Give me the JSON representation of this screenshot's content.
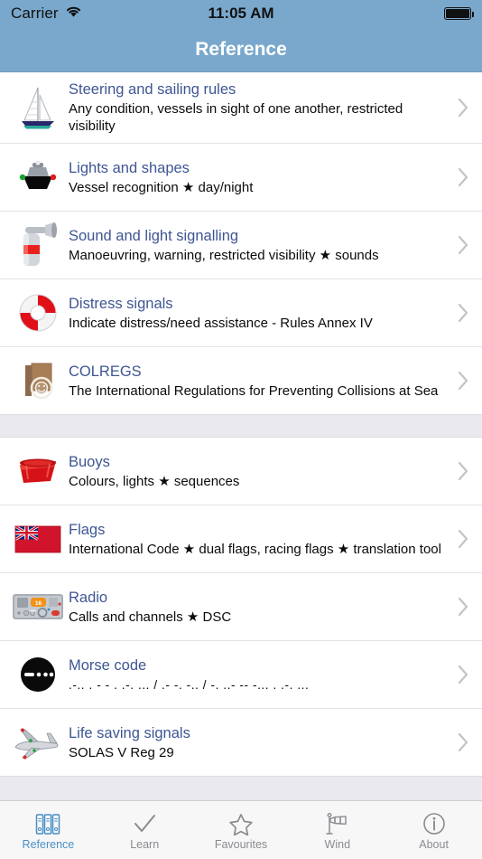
{
  "statusbar": {
    "carrier": "Carrier",
    "wifi_icon": "wifi-icon",
    "time": "11:05 AM",
    "battery_icon": "battery-full-icon"
  },
  "navbar": {
    "title": "Reference"
  },
  "colors": {
    "navbar_bg": "#7aa8cc",
    "row_title": "#3e5693",
    "row_subtitle": "#0b0b0b",
    "tab_active": "#4a90c4",
    "tab_inactive": "#8b8b90",
    "section_gap": "#e9e9ee"
  },
  "sections": [
    {
      "rows": [
        {
          "icon": "sailboat-icon",
          "title": "Steering and sailing rules",
          "subtitle": "Any condition, vessels in sight of one another, restricted visibility"
        },
        {
          "icon": "vessel-bow-lights-icon",
          "title": "Lights and shapes",
          "subtitle": "Vessel recognition ★ day/night"
        },
        {
          "icon": "air-horn-icon",
          "title": "Sound and light signalling",
          "subtitle": "Manoeuvring, warning, restricted visibility ★ sounds"
        },
        {
          "icon": "lifebuoy-icon",
          "title": "Distress signals",
          "subtitle": "Indicate distress/need assistance - Rules Annex IV"
        },
        {
          "icon": "rulebook-icon",
          "title": "COLREGS",
          "subtitle": "The International Regulations for Preventing Collisions at Sea"
        }
      ]
    },
    {
      "rows": [
        {
          "icon": "can-buoy-icon",
          "title": "Buoys",
          "subtitle": "Colours, lights ★ sequences"
        },
        {
          "icon": "red-ensign-flag-icon",
          "title": "Flags",
          "subtitle": "International Code ★ dual flags, racing flags ★ translation tool"
        },
        {
          "icon": "vhf-radio-icon",
          "title": "Radio",
          "subtitle": "Calls and channels ★ DSC"
        },
        {
          "icon": "morse-disc-icon",
          "title": "Morse code",
          "subtitle": ".-.. . - - . .-. ... / .- -. -.. / -. ..- -- -... . .-. ..."
        },
        {
          "icon": "aeroplane-icon",
          "title": "Life saving signals",
          "subtitle": "SOLAS V Reg 29"
        }
      ]
    }
  ],
  "tabbar": {
    "items": [
      {
        "icon": "binders-icon",
        "label": "Reference",
        "active": true
      },
      {
        "icon": "checkmark-icon",
        "label": "Learn",
        "active": false
      },
      {
        "icon": "star-outline-icon",
        "label": "Favourites",
        "active": false
      },
      {
        "icon": "windsock-icon",
        "label": "Wind",
        "active": false
      },
      {
        "icon": "info-circle-icon",
        "label": "About",
        "active": false
      }
    ]
  }
}
